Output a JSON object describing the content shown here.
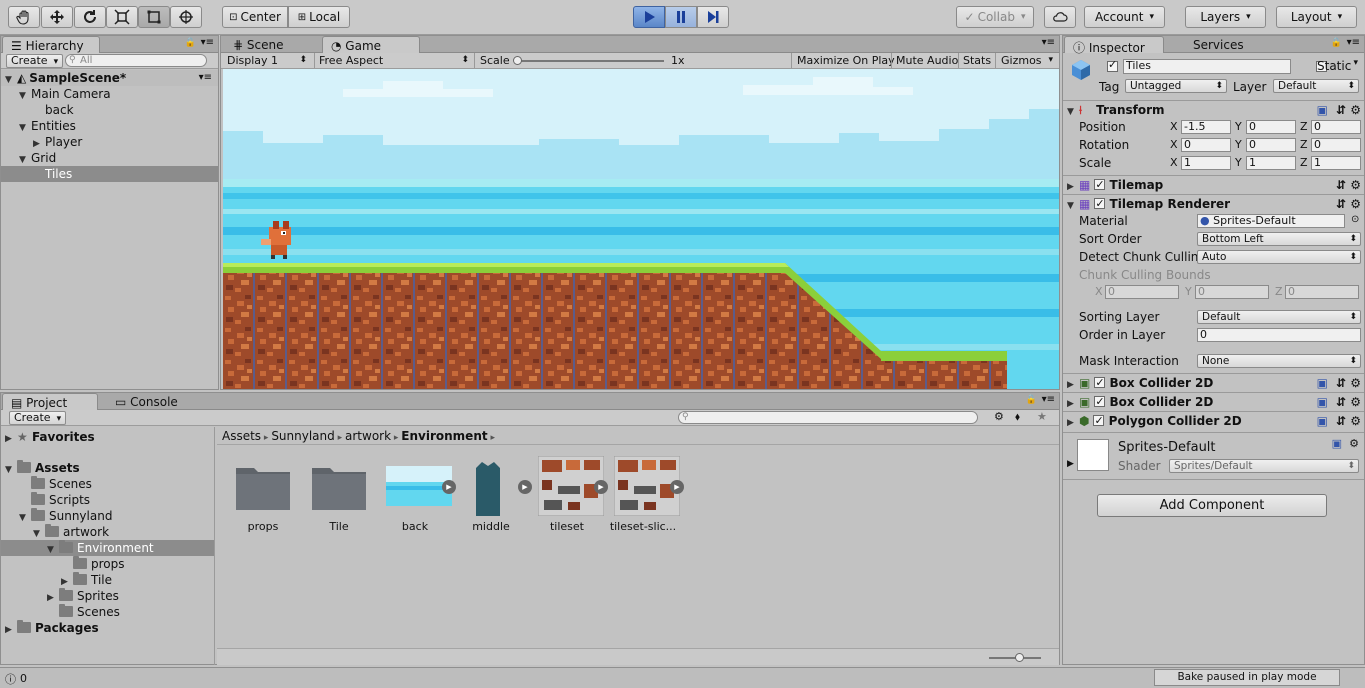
{
  "toolbar": {
    "tools": [
      "hand-tool-icon",
      "move-tool-icon",
      "rotate-tool-icon",
      "scale-tool-icon",
      "rect-tool-icon",
      "transform-tool-icon"
    ],
    "center_label": "Center",
    "local_label": "Local",
    "collab_label": "Collab",
    "account_label": "Account",
    "layers_label": "Layers",
    "layout_label": "Layout"
  },
  "hierarchy": {
    "tab_label": "Hierarchy",
    "create_label": "Create",
    "search_placeholder": "All",
    "scene_name": "SampleScene*",
    "items": [
      {
        "label": "Main Camera",
        "indent": 1,
        "arrow": "▼"
      },
      {
        "label": "back",
        "indent": 2,
        "arrow": ""
      },
      {
        "label": "Entities",
        "indent": 1,
        "arrow": "▼"
      },
      {
        "label": "Player",
        "indent": 2,
        "arrow": "▶"
      },
      {
        "label": "Grid",
        "indent": 1,
        "arrow": "▼"
      },
      {
        "label": "Tiles",
        "indent": 2,
        "arrow": "",
        "selected": true
      }
    ]
  },
  "game": {
    "scene_tab": "Scene",
    "game_tab": "Game",
    "display": "Display 1",
    "aspect": "Free Aspect",
    "scale_label": "Scale",
    "scale_value": "1x",
    "maximize": "Maximize On Play",
    "mute": "Mute Audio",
    "stats": "Stats",
    "gizmos": "Gizmos"
  },
  "project": {
    "tab_label": "Project",
    "console_label": "Console",
    "create_label": "Create",
    "favorites": "Favorites",
    "tree": [
      {
        "label": "Assets",
        "indent": 0,
        "arrow": "▼",
        "bold": true
      },
      {
        "label": "Scenes",
        "indent": 1,
        "arrow": ""
      },
      {
        "label": "Scripts",
        "indent": 1,
        "arrow": ""
      },
      {
        "label": "Sunnyland",
        "indent": 1,
        "arrow": "▼"
      },
      {
        "label": "artwork",
        "indent": 2,
        "arrow": "▼"
      },
      {
        "label": "Environment",
        "indent": 3,
        "arrow": "▼",
        "selected": true
      },
      {
        "label": "props",
        "indent": 4,
        "arrow": ""
      },
      {
        "label": "Tile",
        "indent": 4,
        "arrow": "▶"
      },
      {
        "label": "Sprites",
        "indent": 3,
        "arrow": "▶"
      },
      {
        "label": "Scenes",
        "indent": 3,
        "arrow": ""
      },
      {
        "label": "Packages",
        "indent": 0,
        "arrow": "▶",
        "bold": true
      }
    ],
    "breadcrumb": [
      "Assets",
      "Sunnyland",
      "artwork",
      "Environment"
    ],
    "assets": [
      {
        "label": "props",
        "kind": "folder"
      },
      {
        "label": "Tile",
        "kind": "folder"
      },
      {
        "label": "back",
        "kind": "image-back"
      },
      {
        "label": "middle",
        "kind": "image-middle"
      },
      {
        "label": "tileset",
        "kind": "image-tileset"
      },
      {
        "label": "tileset-slic...",
        "kind": "image-tileset"
      }
    ]
  },
  "inspector": {
    "tab_label": "Inspector",
    "services_label": "Services",
    "object_name": "Tiles",
    "static_label": "Static",
    "tag_label": "Tag",
    "tag_value": "Untagged",
    "layer_label": "Layer",
    "layer_value": "Default",
    "transform": {
      "title": "Transform",
      "position_label": "Position",
      "rotation_label": "Rotation",
      "scale_label": "Scale",
      "position": [
        "-1.5",
        "0",
        "0"
      ],
      "rotation": [
        "0",
        "0",
        "0"
      ],
      "scale": [
        "1",
        "1",
        "1"
      ]
    },
    "tilemap_title": "Tilemap",
    "renderer": {
      "title": "Tilemap Renderer",
      "material_label": "Material",
      "material_value": "Sprites-Default",
      "sort_order_label": "Sort Order",
      "sort_order_value": "Bottom Left",
      "detect_label": "Detect Chunk Culling",
      "detect_value": "Auto",
      "bounds_label": "Chunk Culling Bounds",
      "bounds": [
        "0",
        "0",
        "0"
      ],
      "sorting_layer_label": "Sorting Layer",
      "sorting_layer_value": "Default",
      "order_label": "Order in Layer",
      "order_value": "0",
      "mask_label": "Mask Interaction",
      "mask_value": "None"
    },
    "box_collider_1": "Box Collider 2D",
    "box_collider_2": "Box Collider 2D",
    "polygon_collider": "Polygon Collider 2D",
    "material_name": "Sprites-Default",
    "shader_label": "Shader",
    "shader_value": "Sprites/Default",
    "add_component": "Add Component"
  },
  "status": {
    "console_count": "0",
    "bake_message": "Bake paused in play mode"
  }
}
